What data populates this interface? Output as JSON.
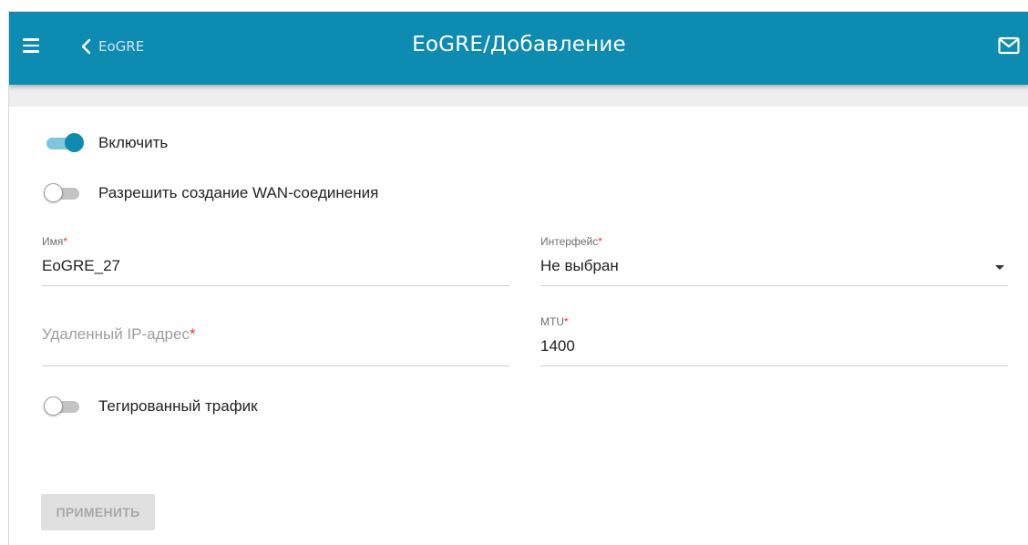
{
  "header": {
    "back_label": "EoGRE",
    "title": "EoGRE/Добавление",
    "menu_icon": "hamburger-menu-icon",
    "mail_icon": "envelope-icon",
    "color": "#0e8bb0"
  },
  "toggles": {
    "enable": {
      "label": "Включить",
      "state": "on"
    },
    "wan": {
      "label": "Разрешить создание WAN-соединения",
      "state": "off"
    },
    "tagged": {
      "label": "Тегированный трафик",
      "state": "off"
    }
  },
  "fields": {
    "name": {
      "label": "Имя",
      "required_mark": "*",
      "value": "EoGRE_27"
    },
    "interface": {
      "label": "Интерфейс",
      "required_mark": "*",
      "value": "Не выбран"
    },
    "remote_ip": {
      "placeholder": "Удаленный IP-адрес",
      "required_mark": "*",
      "value": ""
    },
    "mtu": {
      "label": "MTU",
      "required_mark": "*",
      "value": "1400"
    }
  },
  "actions": {
    "apply_label": "ПРИМЕНИТЬ"
  }
}
